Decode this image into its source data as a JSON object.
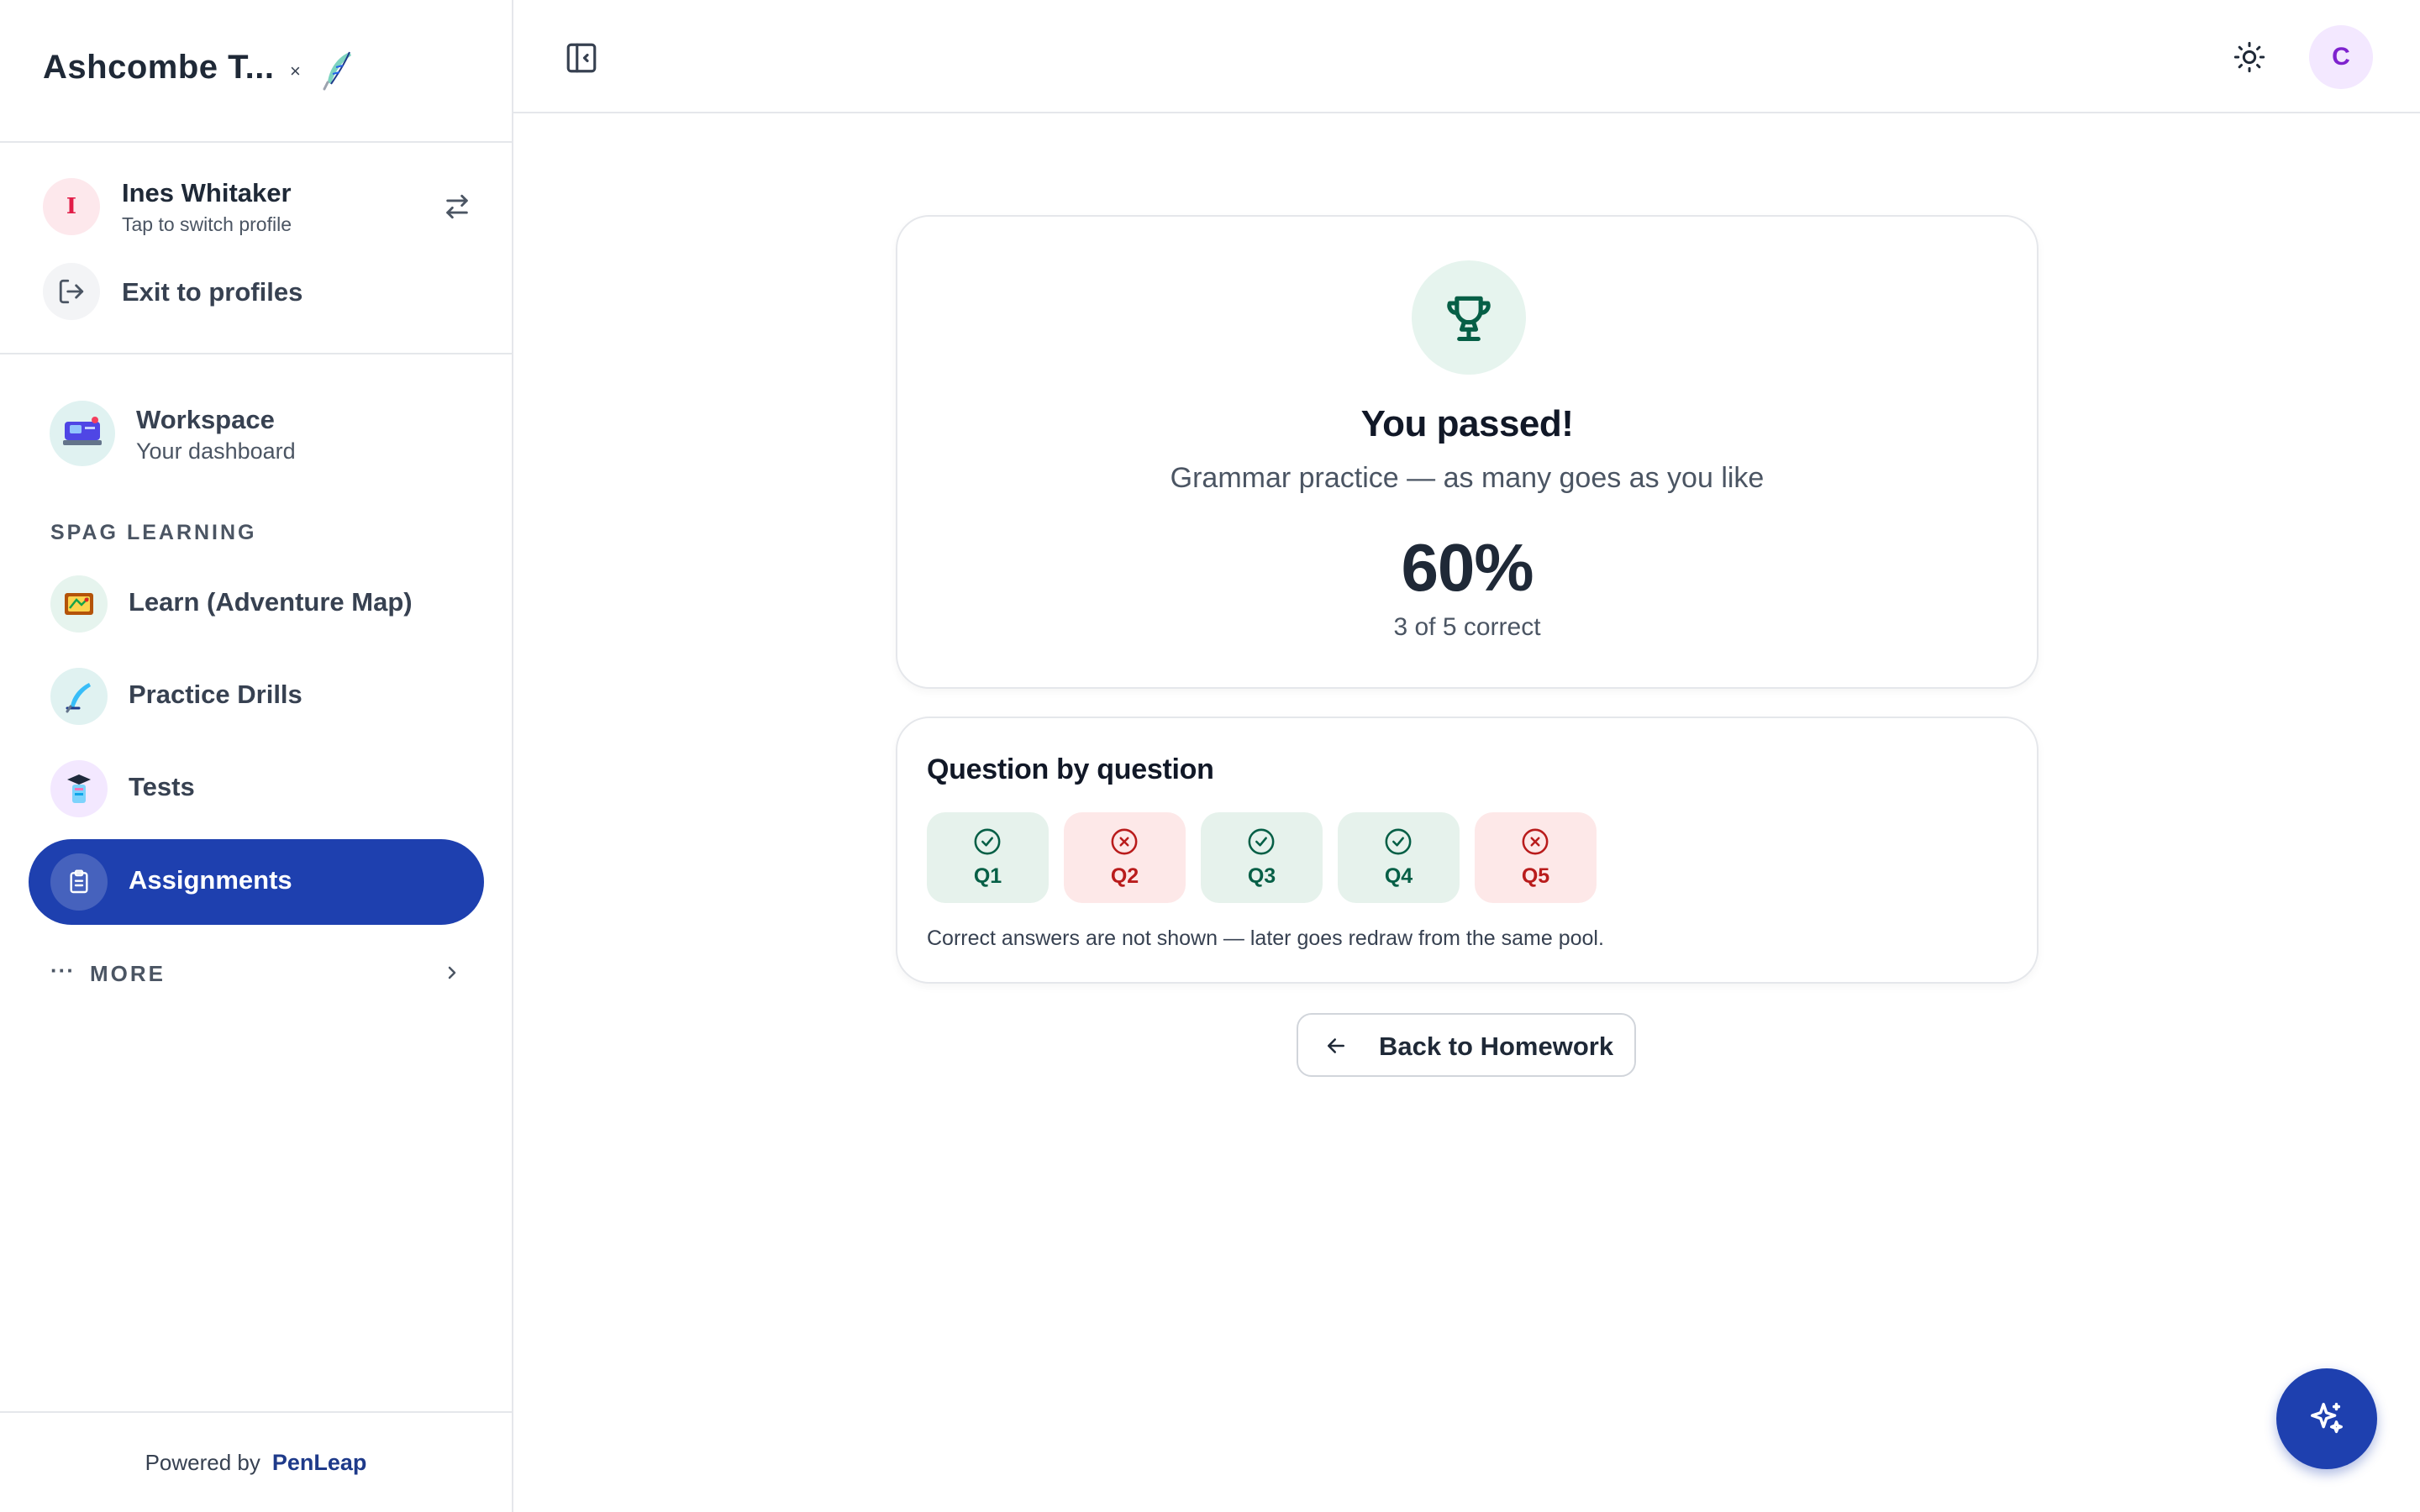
{
  "sidebar": {
    "brand_title": "Ashcombe T...",
    "brand_close": "×",
    "profile": {
      "initial": "I",
      "name": "Ines Whitaker",
      "subtitle": "Tap to switch profile"
    },
    "exit_label": "Exit to profiles",
    "workspace": {
      "title": "Workspace",
      "subtitle": "Your dashboard"
    },
    "section_label": "SPAG LEARNING",
    "items": [
      {
        "label": "Learn (Adventure Map)"
      },
      {
        "label": "Practice Drills"
      },
      {
        "label": "Tests"
      },
      {
        "label": "Assignments",
        "active": true
      }
    ],
    "more_dots": "···",
    "more_label": "MORE",
    "footer": {
      "powered_by": "Powered by",
      "brand": "PenLeap"
    }
  },
  "topbar": {
    "user_initial": "C"
  },
  "result": {
    "title": "You passed!",
    "subtitle": "Grammar practice — as many goes as you like",
    "score": "60%",
    "score_detail": "3 of 5 correct"
  },
  "question_by_question": {
    "title": "Question by question",
    "questions": [
      {
        "label": "Q1",
        "correct": true
      },
      {
        "label": "Q2",
        "correct": false
      },
      {
        "label": "Q3",
        "correct": true
      },
      {
        "label": "Q4",
        "correct": true
      },
      {
        "label": "Q5",
        "correct": false
      }
    ],
    "note": "Correct answers are not shown — later goes redraw from the same pool."
  },
  "back_button_label": "Back to Homework",
  "colors": {
    "primary": "#1e40af",
    "correct_bg": "#e6f2ec",
    "correct_fg": "#065f46",
    "incorrect_bg": "#fde8e8",
    "incorrect_fg": "#b91c1c"
  }
}
